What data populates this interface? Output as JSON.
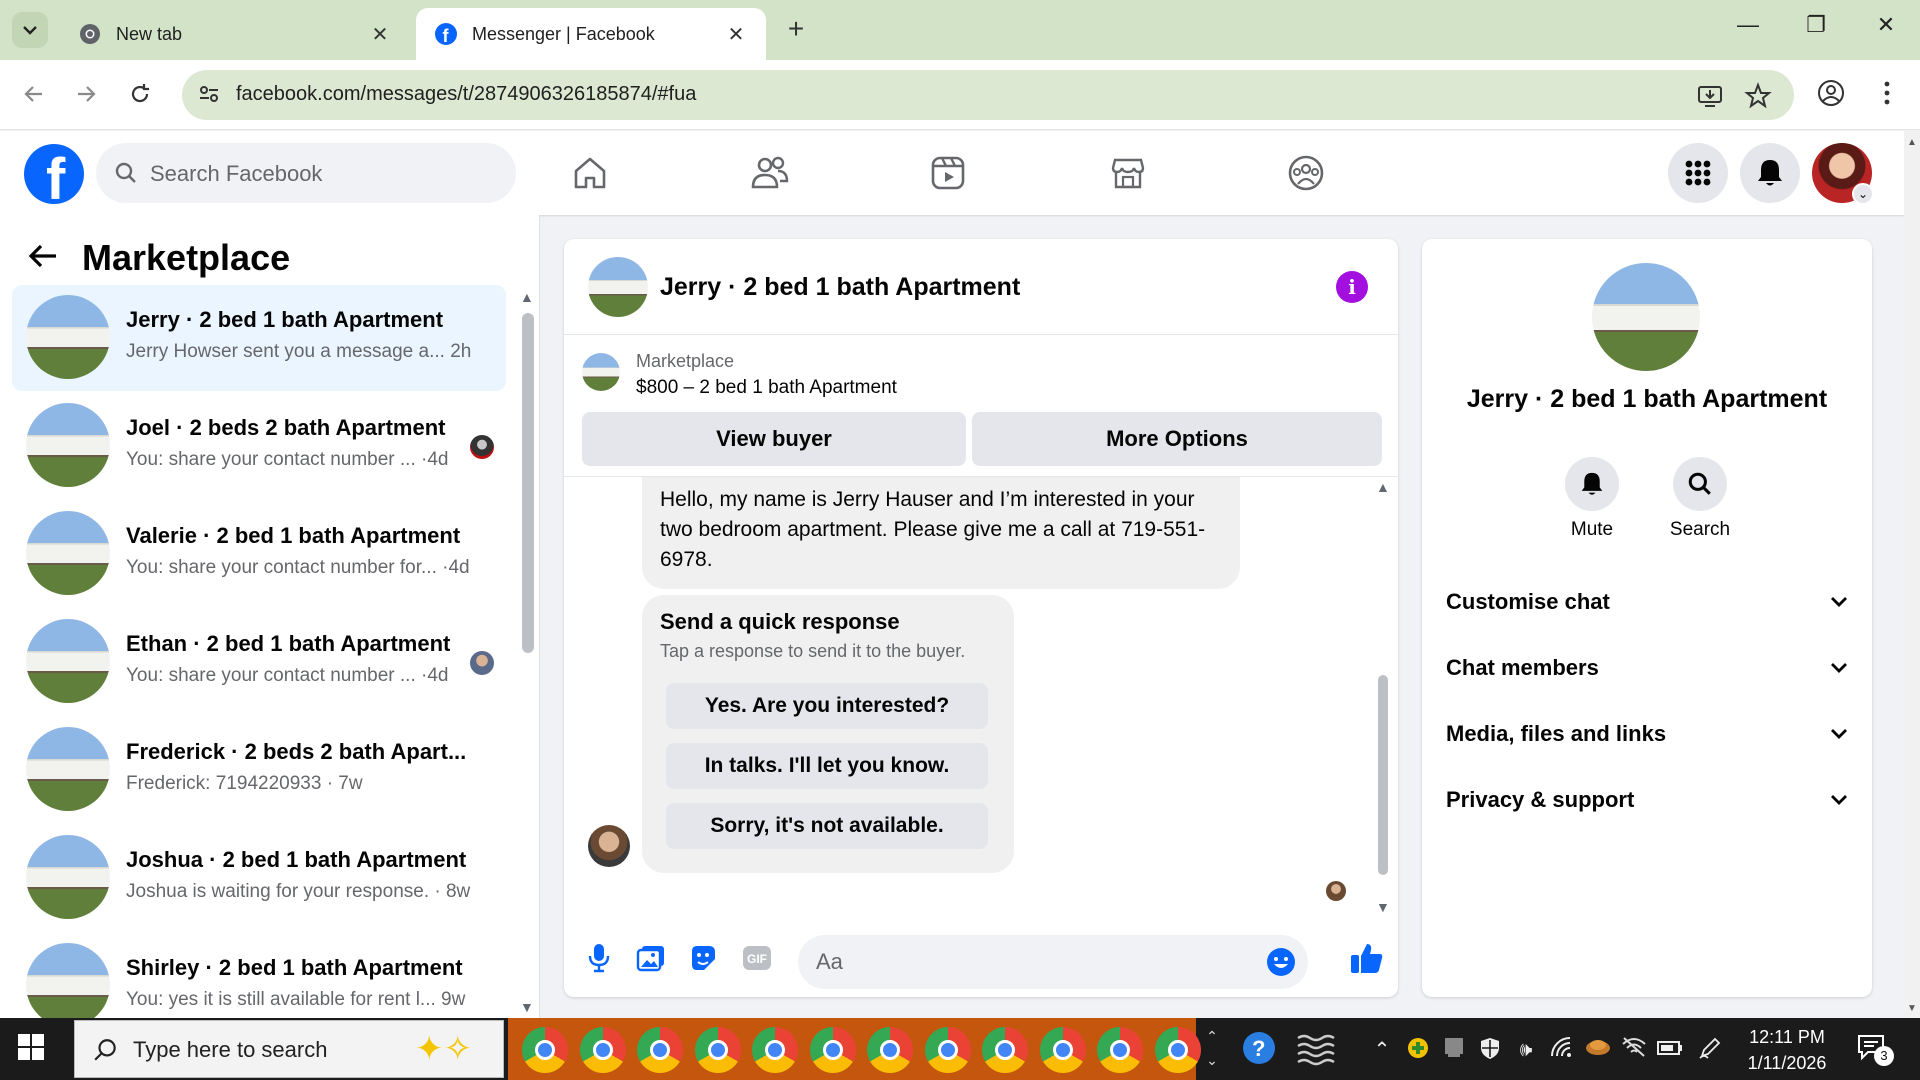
{
  "browser": {
    "tabs": [
      {
        "title": "New tab",
        "active": false
      },
      {
        "title": "Messenger | Facebook",
        "active": true
      }
    ],
    "url": "facebook.com/messages/t/2874906326185874/#fua"
  },
  "fb_header": {
    "search_placeholder": "Search Facebook",
    "nav": [
      "home-icon",
      "friends-icon",
      "video-icon",
      "marketplace-icon",
      "groups-icon"
    ]
  },
  "sidebar": {
    "title": "Marketplace",
    "conversations": [
      {
        "name": "Jerry · 2 bed 1 bath Apartment",
        "preview": "Jerry Howser sent you a message a...  2h",
        "active": true
      },
      {
        "name": "Joel · 2 beds 2 bath Apartment",
        "preview": "You: share your contact number ... ·4d"
      },
      {
        "name": "Valerie · 2 bed 1 bath Apartment",
        "preview": "You: share your contact number for... ·4d"
      },
      {
        "name": "Ethan · 2 bed 1 bath Apartment",
        "preview": "You: share your contact number ... ·4d"
      },
      {
        "name": "Frederick · 2 beds 2 bath Apart...",
        "preview": "Frederick: 7194220933 · 7w"
      },
      {
        "name": "Joshua · 2 bed 1 bath Apartment",
        "preview": "Joshua is waiting for your response. · 8w"
      },
      {
        "name": "Shirley · 2 bed 1 bath Apartment",
        "preview": "You: yes it is still available for rent l...  9w"
      }
    ]
  },
  "chat": {
    "title": "Jerry · 2 bed 1 bath Apartment",
    "listing_source": "Marketplace",
    "listing_title": "$800 – 2 bed 1 bath Apartment",
    "view_buyer": "View buyer",
    "more_options": "More Options",
    "message": "Hello, my name is Jerry Hauser and I’m interested in your two bedroom apartment. Please give me a call at 719-551-6978.",
    "quick_title": "Send a quick response",
    "quick_sub": "Tap a response to send it to the buyer.",
    "quick_responses": [
      "Yes. Are you interested?",
      "In talks. I'll let you know.",
      "Sorry, it's not available."
    ],
    "composer_placeholder": "Aa"
  },
  "info_panel": {
    "title": "Jerry · 2 bed 1 bath Apartment",
    "mute_label": "Mute",
    "search_label": "Search",
    "sections": [
      "Customise chat",
      "Chat members",
      "Media, files and links",
      "Privacy & support"
    ]
  },
  "taskbar": {
    "search_placeholder": "Type here to search",
    "time": "12:11 PM",
    "date": "1/11/2026",
    "notification_count": "3"
  },
  "colors": {
    "fb_blue": "#0866ff",
    "active_conv_bg": "#ebf5ff",
    "info_purple": "#a20fde",
    "browser_frame": "#d3e3c8",
    "taskbar_orange": "#c4560e"
  }
}
